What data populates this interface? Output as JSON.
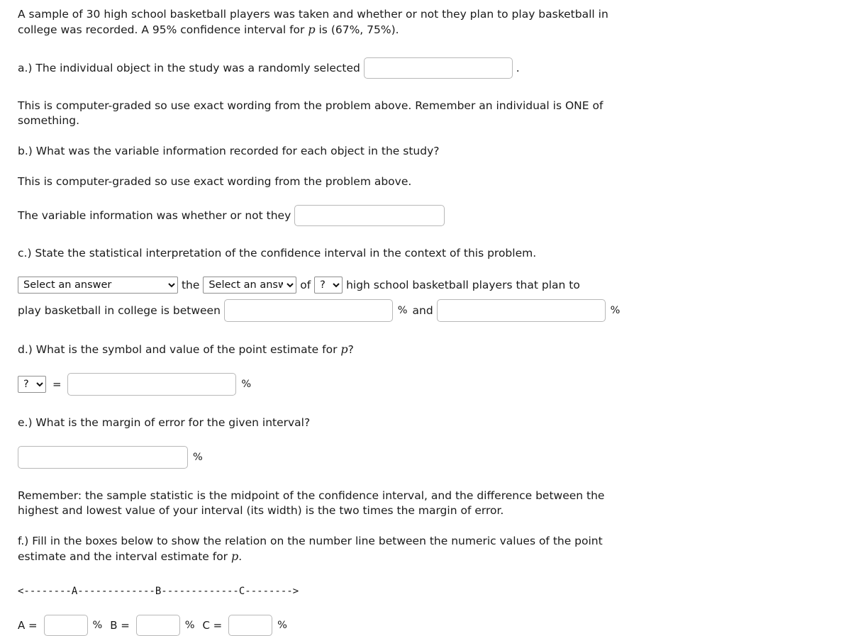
{
  "problem": {
    "intro_line1": "A sample of 30 high school basketball players was taken and whether or not they plan to play basketball in college was recorded. A 95% confidence interval for ",
    "intro_var": "p",
    "intro_line2": " is (67%, 75%)."
  },
  "part_a": {
    "prompt_before": "a.) The individual object in the study was a randomly selected",
    "prompt_after": ".",
    "input_value": "",
    "input_placeholder": "",
    "hint": "This is computer-graded so use exact wording from the problem above. Remember an individual is ONE of something."
  },
  "part_b": {
    "prompt": "b.) What was the variable information recorded for each object in the study?",
    "hint": "This is computer-graded so use exact wording from the problem above.",
    "sentence_before": "The variable information was whether or not they",
    "input_value": "",
    "input_placeholder": ""
  },
  "part_c": {
    "prompt": "c.) State the statistical interpretation of the confidence interval in the context of this problem.",
    "select1_value": "Select an answer",
    "select1_options": [
      "Select an answer"
    ],
    "text_the": "the",
    "select2_value": "Select an answer",
    "select2_options": [
      "Select an answer"
    ],
    "text_of": "of",
    "select3_value": "?",
    "select3_options": [
      "?"
    ],
    "text_tail": "high school basketball players that plan to",
    "text_line2": "play basketball in college is between",
    "input1_value": "",
    "percent1": "%",
    "text_and": "and",
    "input2_value": "",
    "percent2": "%"
  },
  "part_d": {
    "prompt_before": "d.) What is the symbol and value of the point estimate for ",
    "prompt_var": "p",
    "prompt_after": "?",
    "select_value": "?",
    "select_options": [
      "?"
    ],
    "equals": "=",
    "input_value": "",
    "percent": "%"
  },
  "part_e": {
    "prompt": "e.) What is the margin of error for the given interval?",
    "input_value": "",
    "percent": "%",
    "hint": "Remember: the sample statistic is the midpoint of the confidence interval, and the difference between the highest and lowest value of your interval (its width) is the two times the margin of error."
  },
  "part_f": {
    "prompt_before": "f.) Fill in the boxes below to show the relation on the number line between the numeric values of the point estimate and the interval estimate for ",
    "prompt_var": "p",
    "prompt_after": ".",
    "number_line": "<--------A-------------B-------------C-------->",
    "label_a": "A =",
    "input_a_value": "",
    "percent_a": "%",
    "label_b": "B =",
    "input_b_value": "",
    "percent_b": "%",
    "label_c": "C =",
    "input_c_value": "",
    "percent_c": "%"
  },
  "colors": {
    "text": "#1a1a1a",
    "input_border": "#b8b8b8",
    "select_border": "#8f8f8f",
    "background": "#ffffff"
  }
}
